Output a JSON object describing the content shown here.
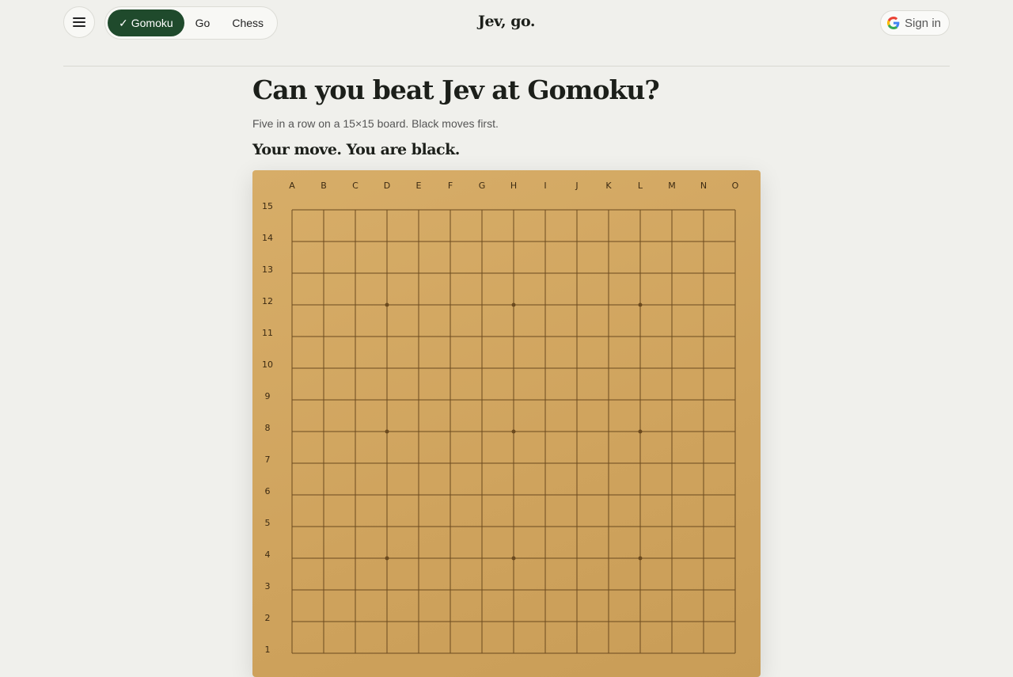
{
  "header": {
    "menu_icon": "hamburger-icon",
    "tabs": [
      {
        "label": "Gomoku",
        "active": true,
        "check": "✓"
      },
      {
        "label": "Go",
        "active": false
      },
      {
        "label": "Chess",
        "active": false
      }
    ],
    "brand": "Jev, go.",
    "signin_label": "Sign in",
    "signin_icon": "google-icon"
  },
  "main": {
    "title": "Can you beat Jev at Gomoku?",
    "subtitle": "Five in a row on a 15×15 board. Black moves first.",
    "status": "Your move. You are black."
  },
  "board": {
    "columns": [
      "A",
      "B",
      "C",
      "D",
      "E",
      "F",
      "G",
      "H",
      "I",
      "J",
      "K",
      "L",
      "M",
      "N",
      "O"
    ],
    "rows": [
      "15",
      "14",
      "13",
      "12",
      "11",
      "10",
      "9",
      "8",
      "7",
      "6",
      "5",
      "4",
      "3",
      "2",
      "1"
    ],
    "star_points": [
      "D12",
      "H12",
      "L12",
      "D8",
      "H8",
      "L8",
      "D4",
      "H4",
      "L4"
    ],
    "colors": {
      "line": "#6b4a1f",
      "label": "#3c2a12"
    }
  }
}
